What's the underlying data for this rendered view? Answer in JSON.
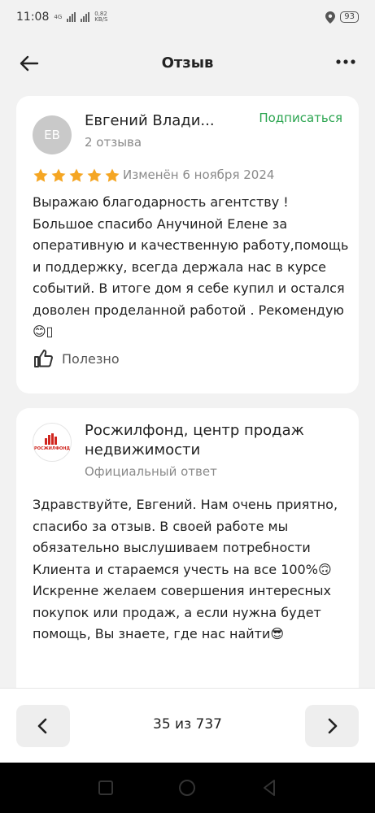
{
  "status": {
    "time": "11:08",
    "net_badge": "4G",
    "speed_value": "0,82",
    "speed_unit": "KB/S",
    "battery": "93"
  },
  "header": {
    "title": "Отзыв",
    "back_icon": "arrow-left-icon",
    "more_icon": "more-dots-icon"
  },
  "review": {
    "avatar_initials": "ЕВ",
    "author": "Евгений Влади...",
    "reviews_count": "2 отзыва",
    "subscribe_label": "Подписаться",
    "rating": 5,
    "edited": "Изменён 6 ноября 2024",
    "text": "Выражаю благодарность агентству ! Большое спасибо Анучиной Елене за оперативную и качественную работу,помощь   и поддержку,  всегда держала нас в курсе событий. В итоге дом я себе купил и остался доволен проделанной работой . Рекомендую😊▯",
    "helpful_label": "Полезно"
  },
  "reply": {
    "logo_text": "РОСЖИЛФОНД",
    "org_name": "Росжилфонд, центр продаж недвижимости",
    "subtitle": "Официальный ответ",
    "text": "Здравствуйте, Евгений. Нам очень приятно, спасибо за отзыв. В своей работе мы обязательно выслушиваем потребности Клиента и стараемся учесть на все 100%🙃 Искренне желаем совершения интересных покупок или продаж, а если нужна будет помощь, Вы знаете, где нас найти😎"
  },
  "pager": {
    "counter": "35 из 737"
  },
  "colors": {
    "accent_green": "#2aa44f",
    "star": "#f5a623",
    "brand_red": "#d0261f"
  }
}
